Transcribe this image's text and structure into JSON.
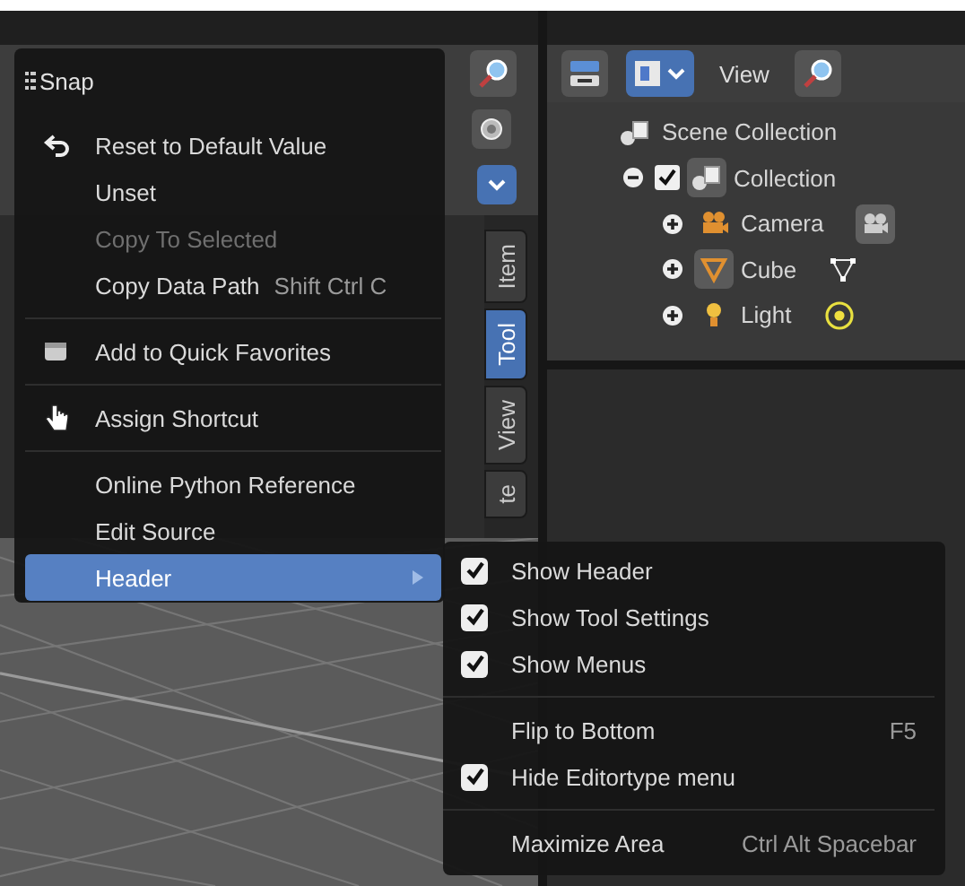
{
  "viewport": {
    "sidebar_tabs": [
      {
        "label": "Item",
        "selected": false
      },
      {
        "label": "Tool",
        "selected": true
      },
      {
        "label": "View",
        "selected": false
      },
      {
        "label": "te",
        "selected": false
      }
    ]
  },
  "outliner": {
    "header": {
      "menu": "View"
    },
    "tree": [
      {
        "name": "Scene Collection",
        "kind": "scene_collection",
        "active": false,
        "children": [
          {
            "name": "Collection",
            "kind": "collection",
            "expanded": true,
            "checked": true,
            "active": true,
            "children": [
              {
                "name": "Camera",
                "kind": "camera",
                "expanded": false,
                "active": false
              },
              {
                "name": "Cube",
                "kind": "mesh",
                "expanded": false,
                "active": true
              },
              {
                "name": "Light",
                "kind": "light",
                "expanded": false,
                "active": false
              }
            ]
          }
        ]
      }
    ]
  },
  "context_menu": {
    "title": "Snap",
    "sections": [
      [
        {
          "label": "Reset to Default Value",
          "disabled": false,
          "selected": false
        },
        {
          "label": "Unset",
          "disabled": false,
          "selected": false
        },
        {
          "label": "Copy To Selected",
          "disabled": true,
          "selected": false
        },
        {
          "label": "Copy Data Path",
          "shortcut": "Shift Ctrl C",
          "disabled": false,
          "selected": false
        }
      ],
      [
        {
          "label": "Add to Quick Favorites",
          "disabled": false,
          "selected": false
        }
      ],
      [
        {
          "label": "Assign Shortcut",
          "disabled": false,
          "selected": false
        }
      ],
      [
        {
          "label": "Online Python Reference",
          "disabled": false,
          "selected": false
        },
        {
          "label": "Edit Source",
          "disabled": false,
          "selected": false
        },
        {
          "label": "Header",
          "submenu": true,
          "disabled": false,
          "selected": true
        }
      ]
    ]
  },
  "submenu": {
    "sections": [
      [
        {
          "label": "Show Header",
          "kind": "toggle",
          "checked": true
        },
        {
          "label": "Show Tool Settings",
          "kind": "toggle",
          "checked": true
        },
        {
          "label": "Show Menus",
          "kind": "toggle",
          "checked": true
        }
      ],
      [
        {
          "label": "Flip to Bottom",
          "kind": "action",
          "shortcut": "F5"
        },
        {
          "label": "Hide Editortype menu",
          "kind": "toggle",
          "checked": true
        }
      ],
      [
        {
          "label": "Maximize Area",
          "kind": "action",
          "shortcut": "Ctrl Alt Spacebar"
        }
      ]
    ]
  }
}
